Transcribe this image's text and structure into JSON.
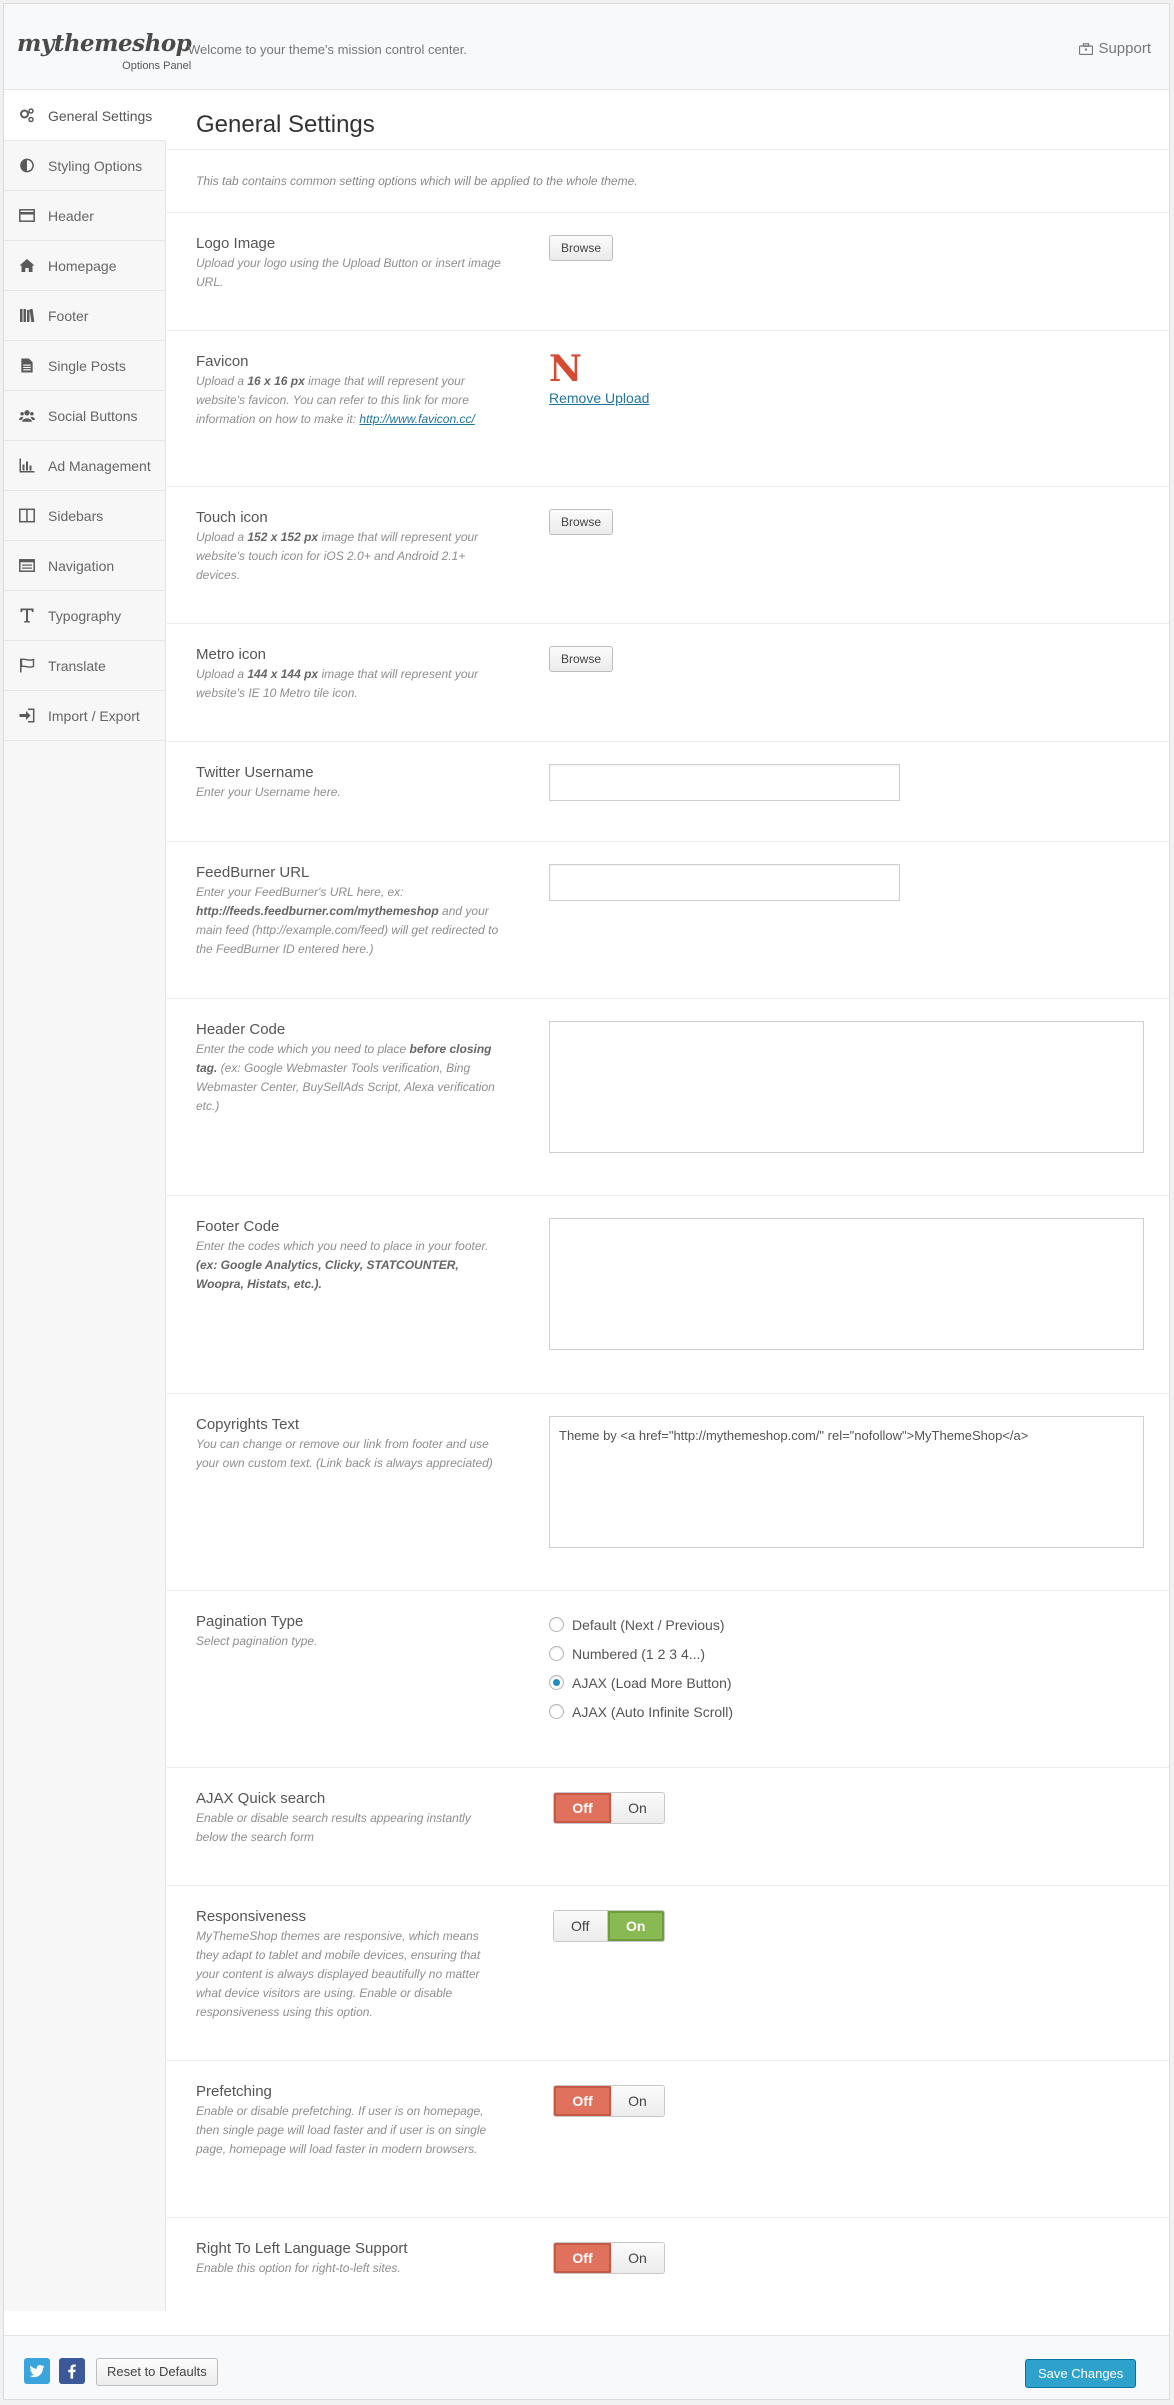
{
  "header": {
    "logo": "mythemeshop",
    "logo_sub": "Options Panel",
    "welcome": "Welcome to your theme's mission control center.",
    "support": "Support"
  },
  "sidebar": {
    "items": [
      {
        "label": "General Settings",
        "icon": "gears-icon"
      },
      {
        "label": "Styling Options",
        "icon": "contrast-icon"
      },
      {
        "label": "Header",
        "icon": "header-card-icon"
      },
      {
        "label": "Homepage",
        "icon": "home-icon"
      },
      {
        "label": "Footer",
        "icon": "books-icon"
      },
      {
        "label": "Single Posts",
        "icon": "document-icon"
      },
      {
        "label": "Social Buttons",
        "icon": "users-icon"
      },
      {
        "label": "Ad Management",
        "icon": "bar-chart-icon"
      },
      {
        "label": "Sidebars",
        "icon": "columns-icon"
      },
      {
        "label": "Navigation",
        "icon": "list-icon"
      },
      {
        "label": "Typography",
        "icon": "text-icon"
      },
      {
        "label": "Translate",
        "icon": "flag-icon"
      },
      {
        "label": "Import / Export",
        "icon": "sign-in-icon"
      }
    ],
    "active_index": 0
  },
  "main": {
    "title": "General Settings",
    "intro": "This tab contains common setting options which will be applied to the whole theme.",
    "logo": {
      "title": "Logo Image",
      "desc": "Upload your logo using the Upload Button or insert image URL.",
      "button": "Browse"
    },
    "favicon": {
      "title": "Favicon",
      "desc_1": "Upload a ",
      "desc_bold": "16 x 16 px",
      "desc_2": " image that will represent your website's favicon. You can refer to this link for more information on how to make it: ",
      "link": "http://www.favicon.cc/",
      "preview_letter": "N",
      "remove": "Remove Upload"
    },
    "touch": {
      "title": "Touch icon",
      "desc_1": "Upload a ",
      "desc_bold": "152 x 152 px",
      "desc_2": " image that will represent your website's touch icon for iOS 2.0+ and Android 2.1+ devices.",
      "button": "Browse"
    },
    "metro": {
      "title": "Metro icon",
      "desc_1": "Upload a ",
      "desc_bold": "144 x 144 px",
      "desc_2": " image that will represent your website's IE 10 Metro tile icon.",
      "button": "Browse"
    },
    "twitter": {
      "title": "Twitter Username",
      "desc": "Enter your Username here.",
      "value": ""
    },
    "feedburner": {
      "title": "FeedBurner URL",
      "desc_1": "Enter your FeedBurner's URL here, ex: ",
      "desc_bold": "http://feeds.feedburner.com/mythemeshop",
      "desc_2": " and your main feed (http://example.com/feed) will get redirected to the FeedBurner ID entered here.)",
      "value": ""
    },
    "header_code": {
      "title": "Header Code",
      "desc_1": "Enter the code which you need to place ",
      "desc_bold": "before closing tag.",
      "desc_2": " (ex: Google Webmaster Tools verification, Bing Webmaster Center, BuySellAds Script, Alexa verification etc.)",
      "value": ""
    },
    "footer_code": {
      "title": "Footer Code",
      "desc_1": "Enter the codes which you need to place in your footer. ",
      "desc_bold": "(ex: Google Analytics, Clicky, STATCOUNTER, Woopra, Histats, etc.).",
      "value": ""
    },
    "copyrights": {
      "title": "Copyrights Text",
      "desc": "You can change or remove our link from footer and use your own custom text. (Link back is always appreciated)",
      "value": "Theme by <a href=\"http://mythemeshop.com/\" rel=\"nofollow\">MyThemeShop</a>"
    },
    "pagination": {
      "title": "Pagination Type",
      "desc": "Select pagination type.",
      "options": [
        "Default (Next / Previous)",
        "Numbered (1 2 3 4...)",
        "AJAX (Load More Button)",
        "AJAX (Auto Infinite Scroll)"
      ],
      "selected": 2
    },
    "ajax_search": {
      "title": "AJAX Quick search",
      "desc": "Enable or disable search results appearing instantly below the search form",
      "off": "Off",
      "on": "On",
      "state": "off"
    },
    "responsive": {
      "title": "Responsiveness",
      "desc": "MyThemeShop themes are responsive, which means they adapt to tablet and mobile devices, ensuring that your content is always displayed beautifully no matter what device visitors are using. Enable or disable responsiveness using this option.",
      "off": "Off",
      "on": "On",
      "state": "on"
    },
    "prefetch": {
      "title": "Prefetching",
      "desc": "Enable or disable prefetching. If user is on homepage, then single page will load faster and if user is on single page, homepage will load faster in modern browsers.",
      "off": "Off",
      "on": "On",
      "state": "off"
    },
    "rtl": {
      "title": "Right To Left Language Support",
      "desc": "Enable this option for right-to-left sites.",
      "off": "Off",
      "on": "On",
      "state": "off"
    }
  },
  "footer": {
    "twitter_icon": "twitter-icon",
    "facebook_icon": "facebook-icon",
    "twitter_color": "#3aa4dc",
    "facebook_color": "#3b5998",
    "reset": "Reset to Defaults",
    "save": "Save Changes"
  }
}
